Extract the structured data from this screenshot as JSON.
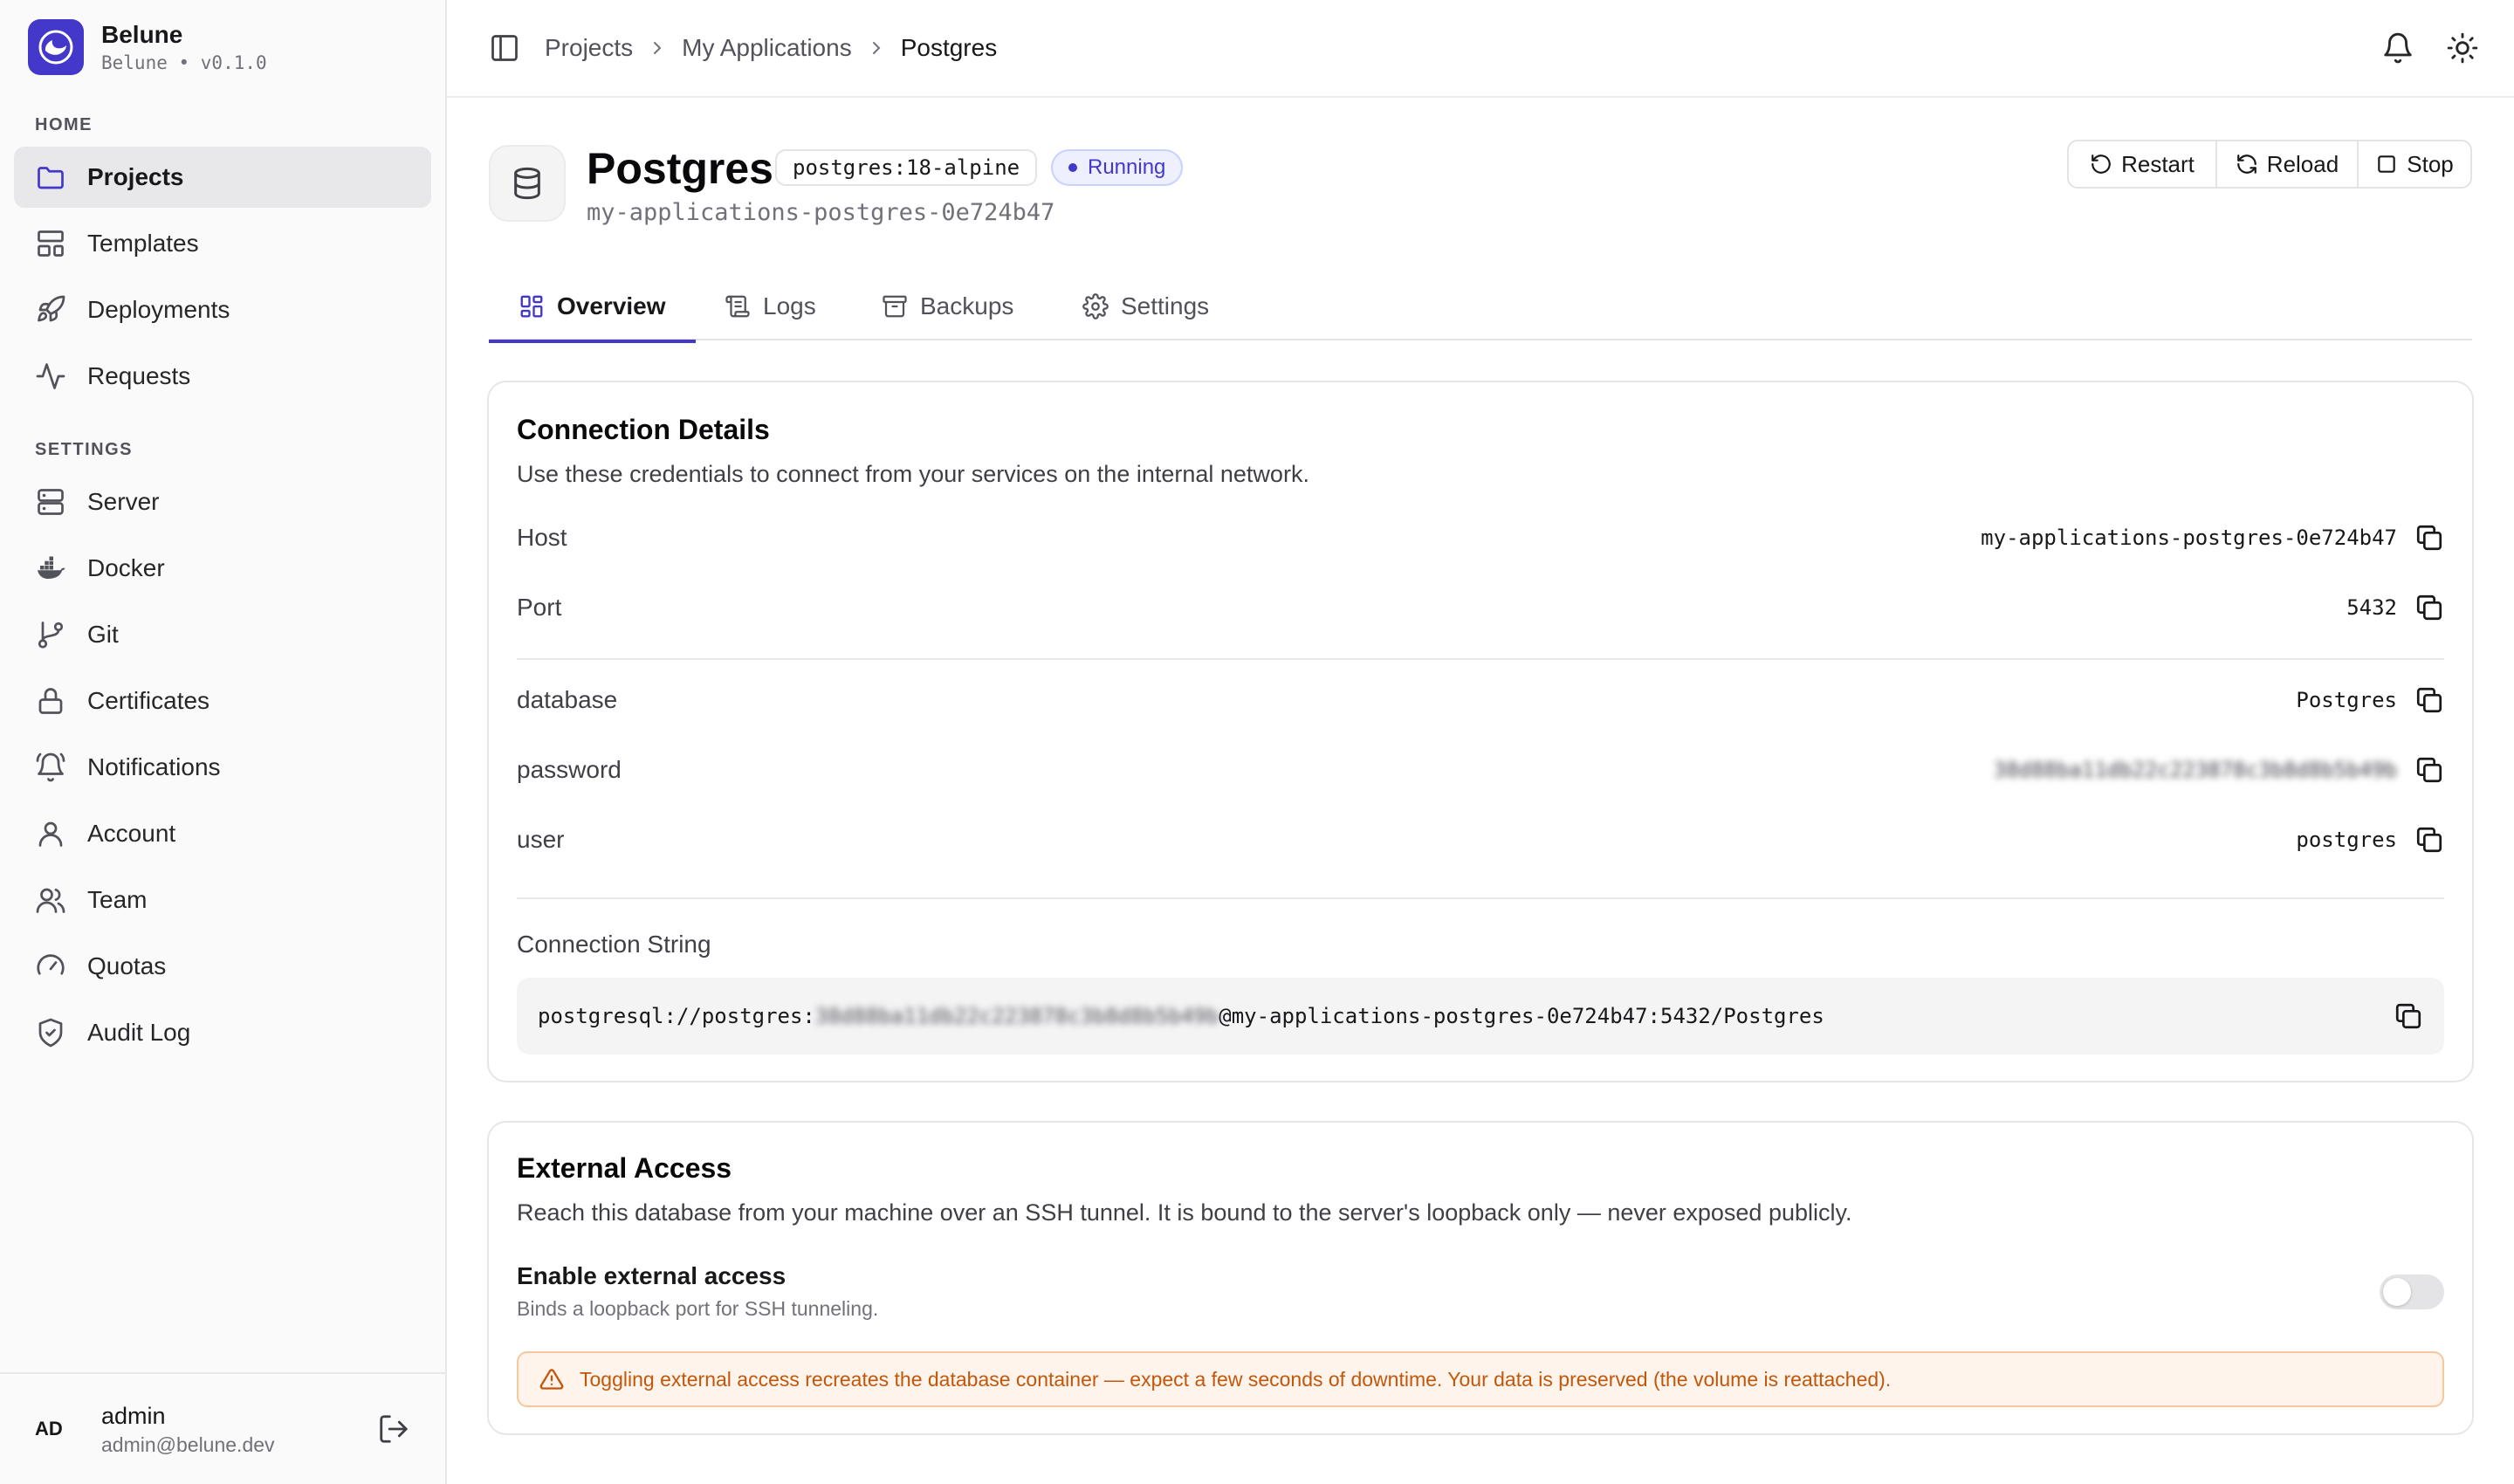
{
  "sidebar": {
    "brand": {
      "name": "Belune",
      "subtitle": "Belune • v0.1.0"
    },
    "sections": {
      "home": "HOME",
      "settings": "SETTINGS"
    },
    "home_items": [
      {
        "label": "Projects",
        "icon": "folder-icon"
      },
      {
        "label": "Templates",
        "icon": "layout-template-icon"
      },
      {
        "label": "Deployments",
        "icon": "rocket-icon"
      },
      {
        "label": "Requests",
        "icon": "activity-icon"
      }
    ],
    "settings_items": [
      {
        "label": "Server",
        "icon": "server-icon"
      },
      {
        "label": "Docker",
        "icon": "docker-icon"
      },
      {
        "label": "Git",
        "icon": "git-branch-icon"
      },
      {
        "label": "Certificates",
        "icon": "lock-icon"
      },
      {
        "label": "Notifications",
        "icon": "bell-ring-icon"
      },
      {
        "label": "Account",
        "icon": "user-icon"
      },
      {
        "label": "Team",
        "icon": "users-icon"
      },
      {
        "label": "Quotas",
        "icon": "gauge-icon"
      },
      {
        "label": "Audit Log",
        "icon": "shield-check-icon"
      }
    ],
    "user": {
      "initials": "AD",
      "name": "admin",
      "email": "admin@belune.dev"
    }
  },
  "header": {
    "breadcrumbs": [
      "Projects",
      "My Applications",
      "Postgres"
    ]
  },
  "service": {
    "title": "Postgres",
    "image": "postgres:18-alpine",
    "status": "Running",
    "container_name": "my-applications-postgres-0e724b47",
    "actions": {
      "restart": "Restart",
      "reload": "Reload",
      "stop": "Stop"
    }
  },
  "tabs": [
    {
      "label": "Overview",
      "icon": "layout-grid-icon",
      "active": true
    },
    {
      "label": "Logs",
      "icon": "scroll-text-icon",
      "active": false
    },
    {
      "label": "Backups",
      "icon": "archive-icon",
      "active": false
    },
    {
      "label": "Settings",
      "icon": "gear-icon",
      "active": false
    }
  ],
  "connection": {
    "title": "Connection Details",
    "description": "Use these credentials to connect from your services on the internal network.",
    "host": {
      "key": "Host",
      "value": "my-applications-postgres-0e724b47"
    },
    "port": {
      "key": "Port",
      "value": "5432"
    },
    "database": {
      "key": "database",
      "value": "Postgres"
    },
    "password": {
      "key": "password",
      "value": "38d88ba11db22c223878c3b8d8b5b49b"
    },
    "user": {
      "key": "user",
      "value": "postgres"
    },
    "string_label": "Connection String",
    "string_prefix": "postgresql://postgres:",
    "string_secret": "38d88ba11db22c223878c3b8d8b5b49b",
    "string_suffix": "@my-applications-postgres-0e724b47:5432/Postgres"
  },
  "external": {
    "title": "External Access",
    "description": "Reach this database from your machine over an SSH tunnel. It is bound to the server's loopback only — never exposed publicly.",
    "toggle_title": "Enable external access",
    "toggle_desc": "Binds a loopback port for SSH tunneling.",
    "enabled": false,
    "warning": "Toggling external access recreates the database container — expect a few seconds of downtime. Your data is preserved (the volume is reattached)."
  },
  "colors": {
    "accent": "#4338ca",
    "warning_text": "#c2570c",
    "warning_bg": "#fff4eb"
  }
}
